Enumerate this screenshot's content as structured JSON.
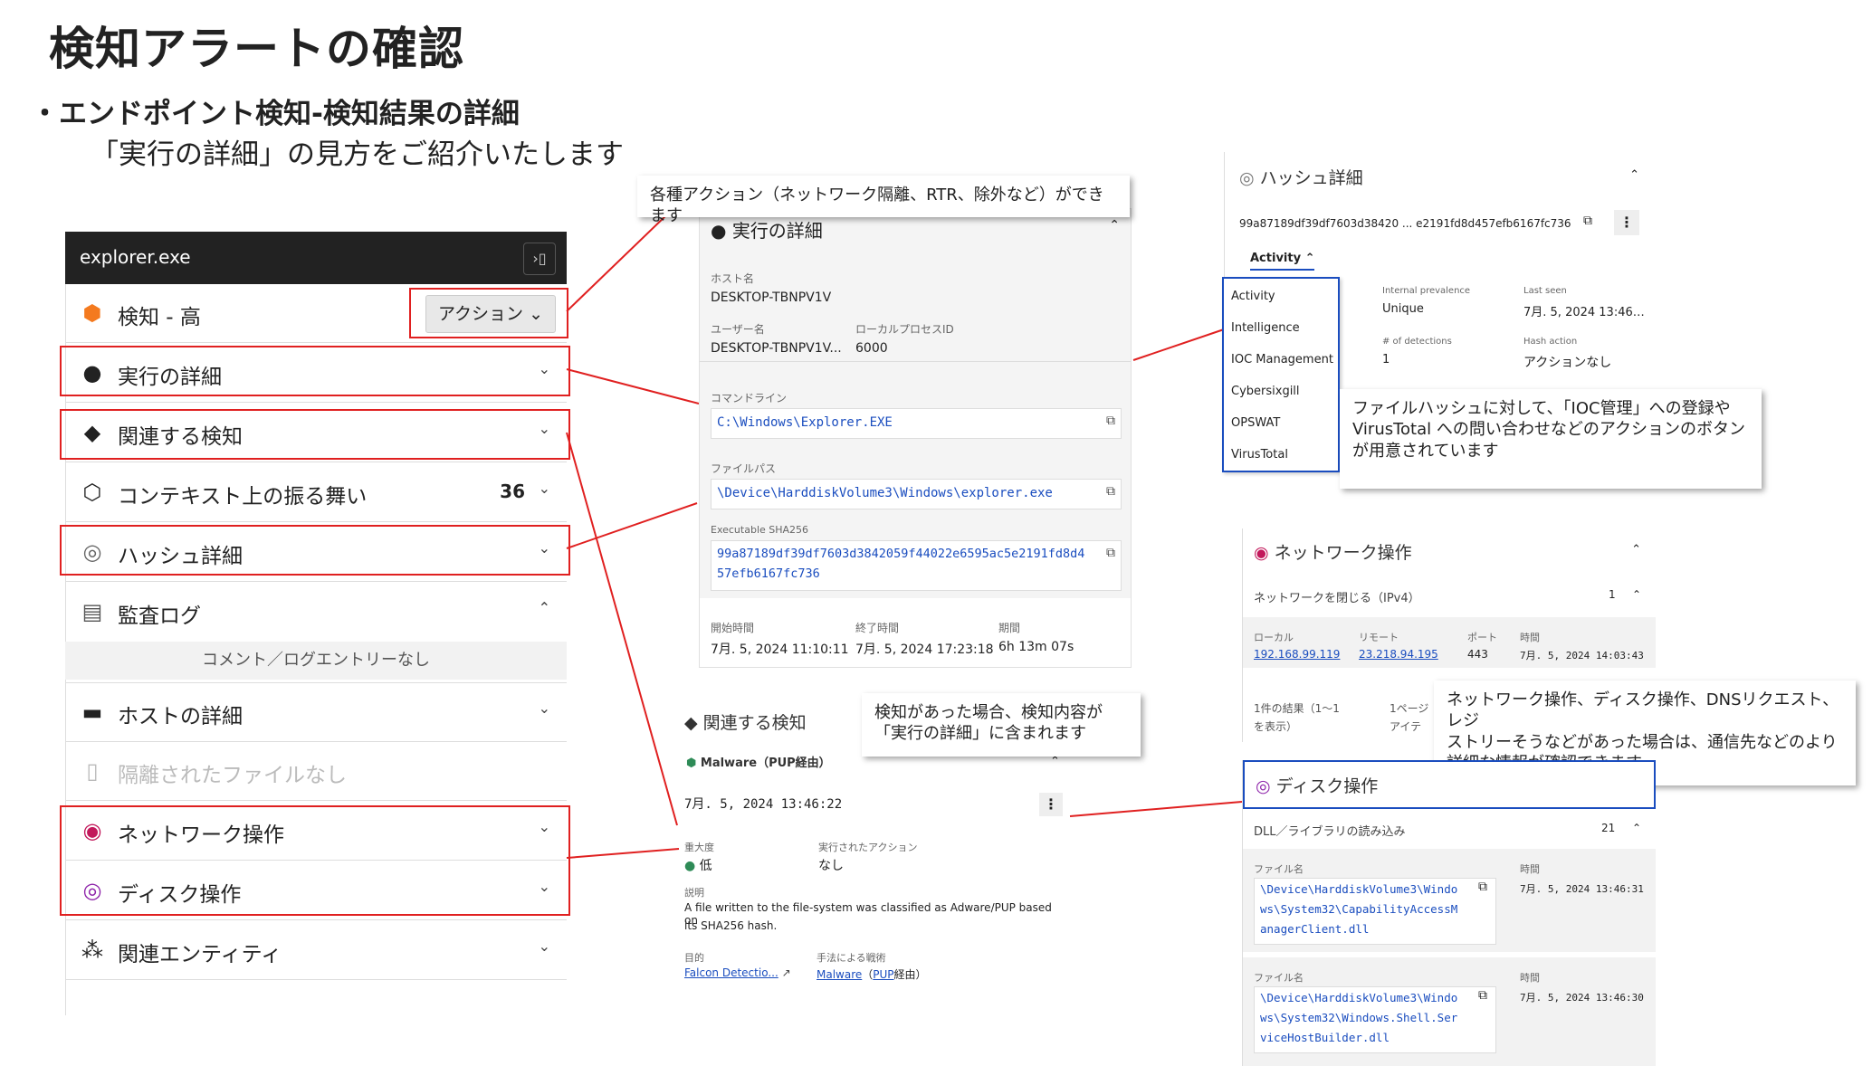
{
  "slide": {
    "title": "検知アラートの確認",
    "subtitle": "・エンドポイント検知-検知結果の詳細",
    "lead": "「実行の詳細」の見方をご紹介いたします"
  },
  "left_panel": {
    "app_title": "explorer.exe",
    "severity_label": "検知 - 高",
    "action_button": "アクション",
    "rows": [
      {
        "label": "実行の詳細"
      },
      {
        "label": "関連する検知"
      },
      {
        "label": "コンテキスト上の振る舞い",
        "count": "36"
      },
      {
        "label": "ハッシュ詳細"
      },
      {
        "label": "監査ログ"
      },
      {
        "label": "ホストの詳細"
      },
      {
        "label": "隔離されたファイルなし"
      },
      {
        "label": "ネットワーク操作"
      },
      {
        "label": "ディスク操作"
      },
      {
        "label": "関連エンティティ"
      }
    ],
    "audit_note": "コメント／ログエントリーなし"
  },
  "exec_panel": {
    "header": "実行の詳細",
    "host_label": "ホスト名",
    "host_value": "DESKTOP-TBNPV1V",
    "user_label": "ユーザー名",
    "user_value": "DESKTOP-TBNPV1V...",
    "pid_label": "ローカルプロセスID",
    "pid_value": "6000",
    "cmd_label": "コマンドライン",
    "cmd_value": "C:\\Windows\\Explorer.EXE",
    "path_label": "ファイルパス",
    "path_value": "\\Device\\HarddiskVolume3\\Windows\\explorer.exe",
    "sha_label": "Executable SHA256",
    "sha_line1": "99a87189df39df7603d3842059f44022e6595ac5e2191fd8d4",
    "sha_line2": "57efb6167fc736",
    "start_label": "開始時間",
    "start_value": "7月. 5, 2024 11:10:11",
    "end_label": "終了時間",
    "end_value": "7月. 5, 2024 17:23:18",
    "dur_label": "期間",
    "dur_value": "6h 13m 07s"
  },
  "hash_panel": {
    "header": "ハッシュ詳細",
    "hash": "99a87189df39df7603d38420 ... e2191fd8d457efb6167fc736",
    "tab": "Activity",
    "menu": [
      "Activity",
      "Intelligence",
      "IOC Management",
      "Cybersixgill",
      "OPSWAT",
      "VirusTotal"
    ],
    "prev_label": "Internal prevalence",
    "prev_value": "Unique",
    "seen_label": "Last seen",
    "seen_value": "7月. 5, 2024 13:46…",
    "det_label": "# of detections",
    "det_value": "1",
    "hact_label": "Hash action",
    "hact_value": "アクションなし"
  },
  "related_panel": {
    "header": "関連する検知",
    "item": "Malware（PUP経由）",
    "time": "7月. 5, 2024 13:46:22",
    "sev_label": "重大度",
    "sev_value": "低",
    "exec_label": "実行されたアクション",
    "exec_value": "なし",
    "desc_label": "説明",
    "desc_value1": "A file written to the file-system was classified as Adware/PUP based on",
    "desc_value2": "its SHA256 hash.",
    "obj_label": "目的",
    "obj_value": "Falcon Detectio...",
    "tech_label": "手法による戦術",
    "tech_link": "Malware",
    "tech_pre": "（",
    "tech_link2": "PUP",
    "tech_suffix": "経由）"
  },
  "net_panel": {
    "header": "ネットワーク操作",
    "sub": "ネットワークを閉じる（IPv4）",
    "sub_count": "1",
    "col_local": "ローカル",
    "col_remote": "リモート",
    "col_port": "ポート",
    "col_time": "時間",
    "local": "192.168.99.119",
    "remote": "23.218.94.195",
    "port": "443",
    "time": "7月. 5, 2024 14:03:43",
    "result1": "1件の結果（1〜1",
    "result2": "を表示）",
    "page1": "1ページ",
    "page2": "アイテ"
  },
  "disk_panel": {
    "header": "ディスク操作",
    "sub": "DLL／ライブラリの読み込み",
    "sub_count": "21",
    "file_label": "ファイル名",
    "time_label": "時間",
    "file1_l1": "\\Device\\HarddiskVolume3\\Windo",
    "file1_l2": "ws\\System32\\CapabilityAccessM",
    "file1_l3": "anagerClient.dll",
    "time1": "7月. 5, 2024 13:46:31",
    "file2_l1": "\\Device\\HarddiskVolume3\\Windo",
    "file2_l2": "ws\\System32\\Windows.Shell.Ser",
    "file2_l3": "viceHostBuilder.dll",
    "time2": "7月. 5, 2024 13:46:30"
  },
  "callouts": {
    "actions": "各種アクション（ネットワーク隔離、RTR、除外など）ができます",
    "related1": "検知があった場合、検知内容が",
    "related2": "「実行の詳細」に含まれます",
    "hash1": "ファイルハッシュに対して、「IOC管理」への登録や",
    "hash2": "VirusTotal への問い合わせなどのアクションのボタン",
    "hash3": "が用意されています",
    "net1": "ネットワーク操作、ディスク操作、DNSリクエスト、レジ",
    "net2": "ストリーそうなどがあった場合は、通信先などのより",
    "net3": "詳細な情報が確認できます"
  },
  "colors": {
    "red": "#e02020",
    "link": "#1a4dbf",
    "orange": "#f47a1f",
    "magenta": "#c2185b",
    "purple": "#8e24aa"
  }
}
